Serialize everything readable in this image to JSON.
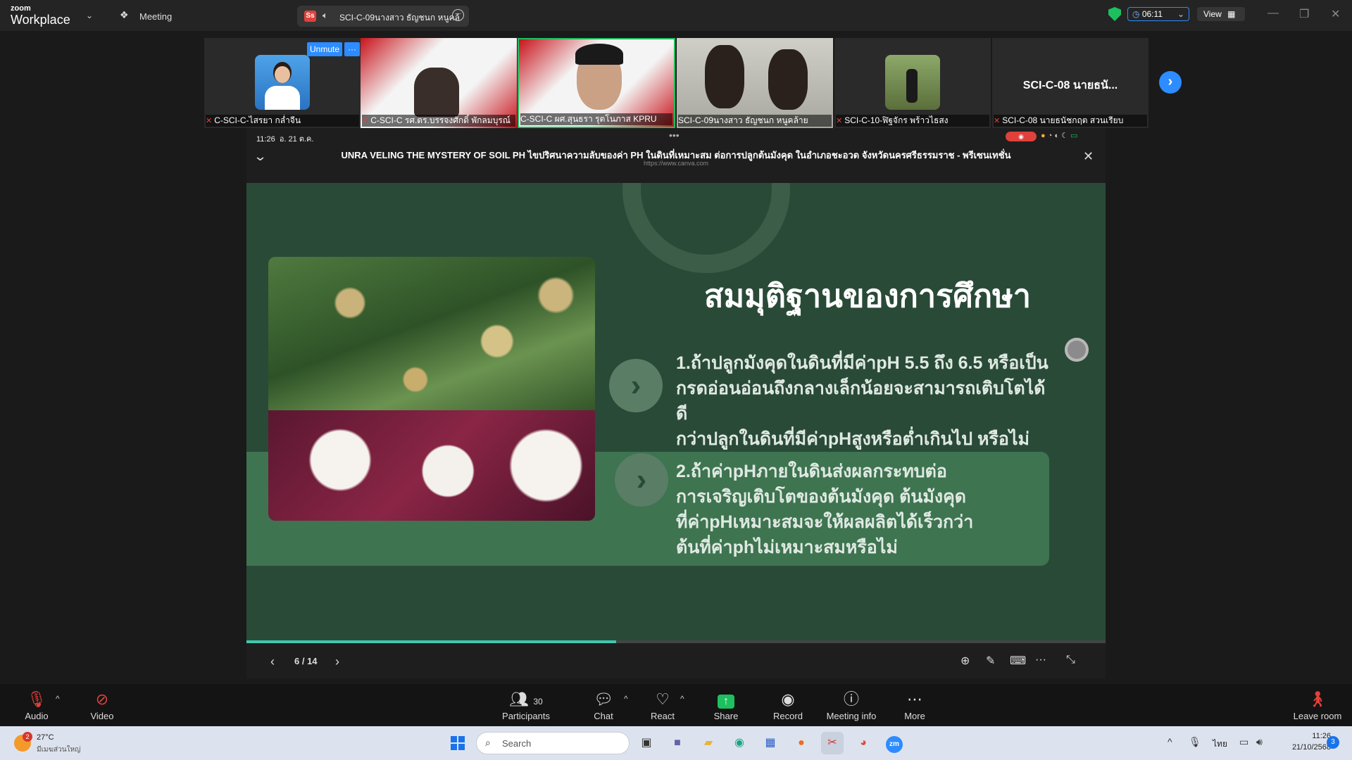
{
  "app": {
    "logo_small": "zoom",
    "logo_big": "Workplace",
    "meeting_tab": "Meeting"
  },
  "share_tab": {
    "badge": "Ss",
    "label": "SCI-C-09นางสาว ธัญชนก หนูคล้"
  },
  "timer": "06:11",
  "view_label": "View",
  "participants": [
    {
      "name": "C-SCI-C-ไสรยา กล่ำจีน",
      "unmute_label": "Unmute"
    },
    {
      "name": "C-SCI-C รศ.ดร.บรรจงศักดิ์ พักลมบุรณ์"
    },
    {
      "name": "C-SCI-C ผศ.สุนธรา รุตโนภาส KPRU"
    },
    {
      "name": "SCI-C-09นางสาว ธัญชนก หนูคล้าย"
    },
    {
      "name": "SCI-C-10-ฬิฐจักร พร้าวไธสง"
    },
    {
      "name": "SCI-C-08 นายธนัชกฤต สวนเรียบ",
      "big_label": "SCI-C-08 นายธนั..."
    }
  ],
  "phone_status": {
    "time": "11:26",
    "date": "อ. 21 ต.ค."
  },
  "shared": {
    "title": "UNRA VELING THE MYSTERY OF SOIL PH ไขปริศนาความลับของค่า PH ในดินที่เหมาะสม ต่อการปลูกต้นมังคุด ในอำเภอชะอวด จังหวัดนครศรีธรรมราช - พรีเซนเทชั่น",
    "url": "https://www.canva.com"
  },
  "slide": {
    "heading": "สมมุติฐานของการศึกษา",
    "point1": [
      "1.ถ้าปลูกมังคุดในดินที่มีค่าpH 5.5 ถึง 6.5 หรือเป็น",
      "กรดอ่อนอ่อนถึงกลางเล็กน้อยจะสามารถเติบโตได้ดี",
      "กว่าปลูกในดินที่มีค่าpHสูงหรือต่ำเกินไป หรือไม่"
    ],
    "point2": [
      "2.ถ้าค่าpHภายในดินส่งผลกระทบต่อ",
      "การเจริญเติบโตของต้นมังคุด ต้นมังคุด",
      "ที่ค่าpHเหมาะสมจะให้ผลผลิตได้เร็วกว่า",
      "ต้นที่ค่าphไม่เหมาะสมหรือไม่"
    ]
  },
  "pager": {
    "label": "6 / 14",
    "progress": 0.43
  },
  "toolbar": {
    "audio": "Audio",
    "video": "Video",
    "participants": "Participants",
    "participants_count": "30",
    "chat": "Chat",
    "react": "React",
    "share": "Share",
    "record": "Record",
    "meeting_info": "Meeting info",
    "more": "More",
    "leave": "Leave room"
  },
  "taskbar": {
    "weather_temp": "27°C",
    "weather_desc": "มีเมฆส่วนใหญ่",
    "weather_badge": "2",
    "search": "Search",
    "lang": "ไทย",
    "time": "11:26",
    "date": "21/10/2568",
    "notif": "3"
  },
  "colors": {
    "accent": "#2d8cff",
    "slide_bg": "#2a4a38",
    "slide_band": "#3e7450",
    "red": "#e0413b",
    "progress": "#3ec9b0"
  }
}
